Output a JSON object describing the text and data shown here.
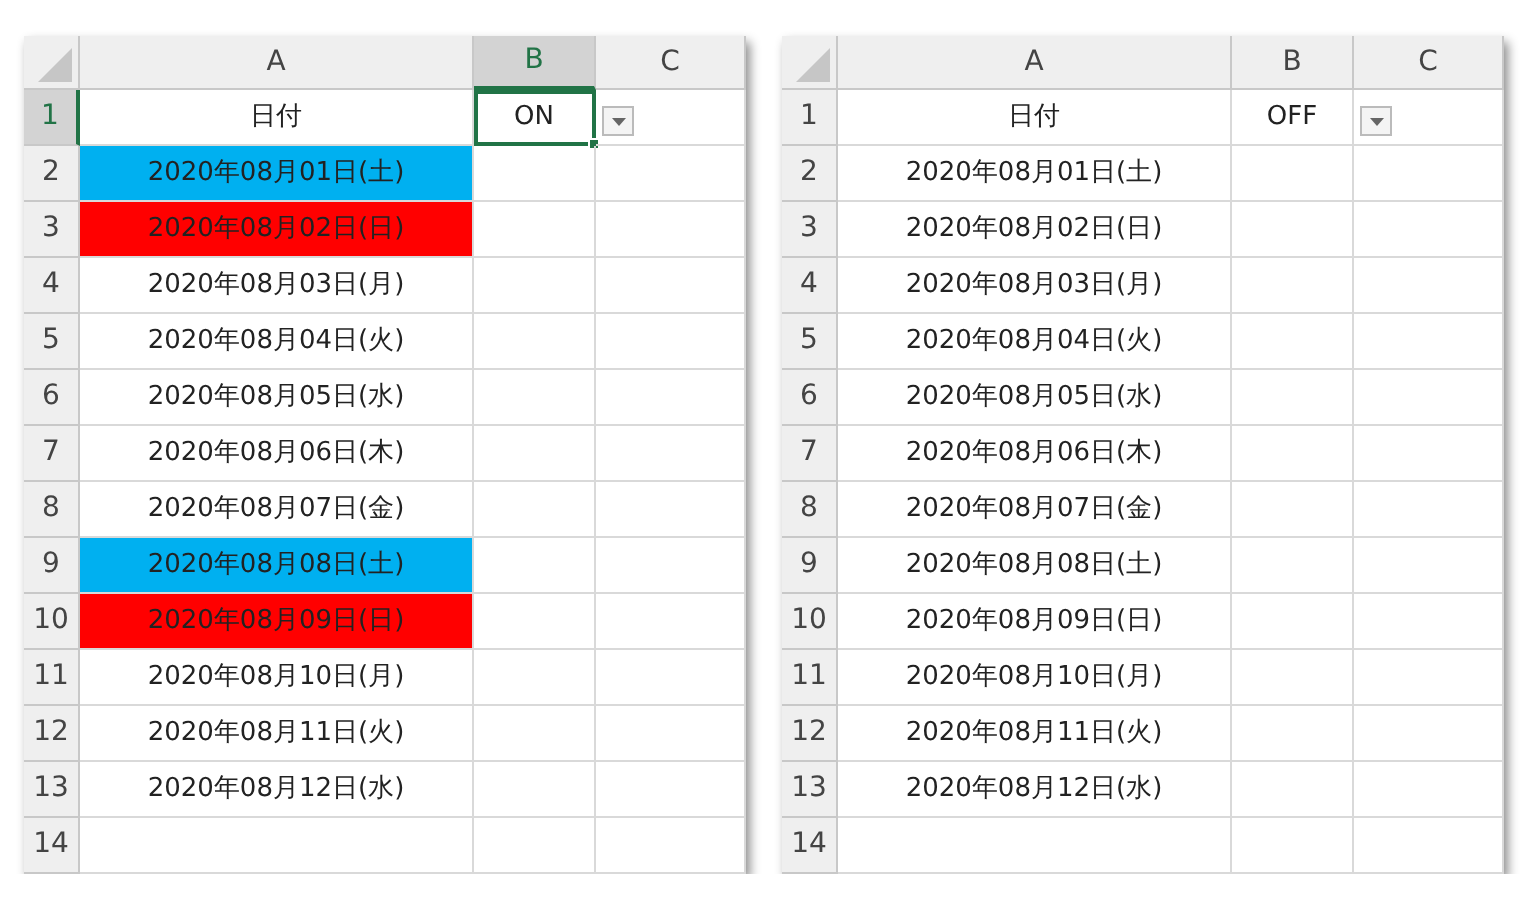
{
  "sheets": [
    {
      "filter_button": true,
      "columns": [
        {
          "label": "A",
          "selected": false
        },
        {
          "label": "B",
          "selected": true
        },
        {
          "label": "C",
          "selected": false
        }
      ],
      "rows": [
        {
          "number": "1",
          "selected": true,
          "cells": [
            {
              "text": "日付",
              "selected": false
            },
            {
              "text": "ON",
              "selected": true
            }
          ]
        },
        {
          "number": "2",
          "selected": false,
          "color": "#00b0f0",
          "cells": [
            {
              "text": "2020年08月01日(土)",
              "selected": false
            }
          ]
        },
        {
          "number": "3",
          "selected": false,
          "color": "#ff0000",
          "cells": [
            {
              "text": "2020年08月02日(日)",
              "selected": false
            }
          ]
        },
        {
          "number": "4",
          "selected": false,
          "cells": [
            {
              "text": "2020年08月03日(月)",
              "selected": false
            }
          ]
        },
        {
          "number": "5",
          "selected": false,
          "cells": [
            {
              "text": "2020年08月04日(火)",
              "selected": false
            }
          ]
        },
        {
          "number": "6",
          "selected": false,
          "cells": [
            {
              "text": "2020年08月05日(水)",
              "selected": false
            }
          ]
        },
        {
          "number": "7",
          "selected": false,
          "cells": [
            {
              "text": "2020年08月06日(木)",
              "selected": false
            }
          ]
        },
        {
          "number": "8",
          "selected": false,
          "cells": [
            {
              "text": "2020年08月07日(金)",
              "selected": false
            }
          ]
        },
        {
          "number": "9",
          "selected": false,
          "color": "#00b0f0",
          "cells": [
            {
              "text": "2020年08月08日(土)",
              "selected": false
            }
          ]
        },
        {
          "number": "10",
          "selected": false,
          "color": "#ff0000",
          "cells": [
            {
              "text": "2020年08月09日(日)",
              "selected": false
            }
          ]
        },
        {
          "number": "11",
          "selected": false,
          "cells": [
            {
              "text": "2020年08月10日(月)",
              "selected": false
            }
          ]
        },
        {
          "number": "12",
          "selected": false,
          "cells": [
            {
              "text": "2020年08月11日(火)",
              "selected": false
            }
          ]
        },
        {
          "number": "13",
          "selected": false,
          "cells": [
            {
              "text": "2020年08月12日(水)",
              "selected": false
            }
          ]
        },
        {
          "number": "14",
          "selected": false
        }
      ]
    },
    {
      "filter_button": true,
      "columns": [
        {
          "label": "A",
          "selected": false
        },
        {
          "label": "B",
          "selected": false
        },
        {
          "label": "C",
          "selected": false
        }
      ],
      "rows": [
        {
          "number": "1",
          "selected": false,
          "cells": [
            {
              "text": "日付",
              "selected": false
            },
            {
              "text": "OFF",
              "selected": false
            }
          ]
        },
        {
          "number": "2",
          "selected": false,
          "cells": [
            {
              "text": "2020年08月01日(土)",
              "selected": false
            }
          ]
        },
        {
          "number": "3",
          "selected": false,
          "cells": [
            {
              "text": "2020年08月02日(日)",
              "selected": false
            }
          ]
        },
        {
          "number": "4",
          "selected": false,
          "cells": [
            {
              "text": "2020年08月03日(月)",
              "selected": false
            }
          ]
        },
        {
          "number": "5",
          "selected": false,
          "cells": [
            {
              "text": "2020年08月04日(火)",
              "selected": false
            }
          ]
        },
        {
          "number": "6",
          "selected": false,
          "cells": [
            {
              "text": "2020年08月05日(水)",
              "selected": false
            }
          ]
        },
        {
          "number": "7",
          "selected": false,
          "cells": [
            {
              "text": "2020年08月06日(木)",
              "selected": false
            }
          ]
        },
        {
          "number": "8",
          "selected": false,
          "cells": [
            {
              "text": "2020年08月07日(金)",
              "selected": false
            }
          ]
        },
        {
          "number": "9",
          "selected": false,
          "cells": [
            {
              "text": "2020年08月08日(土)",
              "selected": false
            }
          ]
        },
        {
          "number": "10",
          "selected": false,
          "cells": [
            {
              "text": "2020年08月09日(日)",
              "selected": false
            }
          ]
        },
        {
          "number": "11",
          "selected": false,
          "cells": [
            {
              "text": "2020年08月10日(月)",
              "selected": false
            }
          ]
        },
        {
          "number": "12",
          "selected": false,
          "cells": [
            {
              "text": "2020年08月11日(火)",
              "selected": false
            }
          ]
        },
        {
          "number": "13",
          "selected": false,
          "cells": [
            {
              "text": "2020年08月12日(水)",
              "selected": false
            }
          ]
        },
        {
          "number": "14",
          "selected": false
        }
      ]
    }
  ]
}
